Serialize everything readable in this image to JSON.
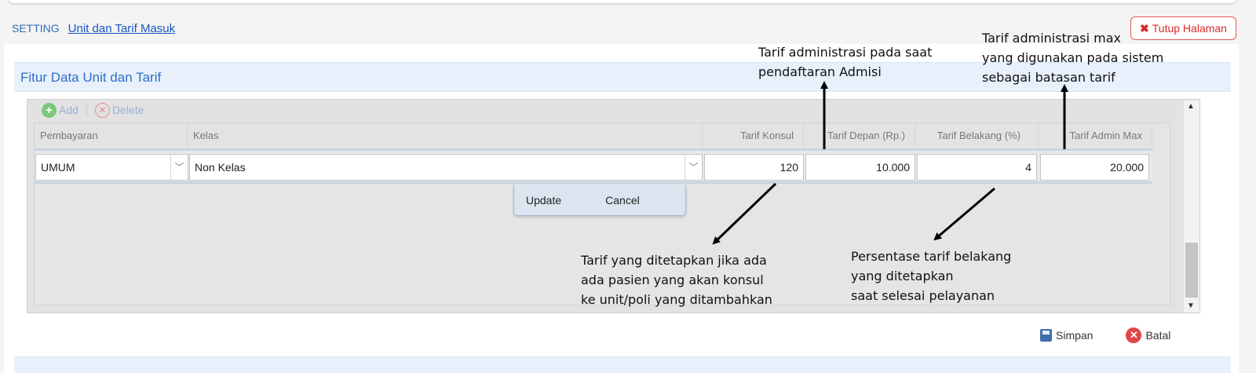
{
  "breadcrumb": {
    "setting": "SETTING",
    "current": "Unit dan Tarif Masuk"
  },
  "close_button": {
    "label": "Tutup Halaman",
    "icon": "close-icon"
  },
  "panel": {
    "title": "Fitur Data Unit dan Tarif"
  },
  "toolbar": {
    "add_label": "Add",
    "delete_label": "Delete"
  },
  "grid": {
    "columns": [
      "Pembayaran",
      "Kelas",
      "Tarif Konsul",
      "Tarif Depan (Rp.)",
      "Tarif Belakang (%)",
      "Tarif Admin Max"
    ],
    "edit_row": {
      "pembayaran": "UMUM",
      "kelas": "Non Kelas",
      "tarif_konsul": "120",
      "tarif_depan": "10.000",
      "tarif_belakang": "4",
      "tarif_admin_max": "20.000"
    },
    "row_editor": {
      "update_label": "Update",
      "cancel_label": "Cancel"
    }
  },
  "footer": {
    "save_label": "Simpan",
    "cancel_label": "Batal"
  },
  "annotations": {
    "admisi": "Tarif administrasi pada saat\npendaftaran Admisi",
    "admin_max": "Tarif administrasi max\nyang digunakan pada sistem\nsebagai batasan tarif",
    "konsul": "Tarif yang ditetapkan jika ada\nada pasien yang akan konsul\nke unit/poli yang ditambahkan",
    "belakang": "Persentase tarif belakang\nyang ditetapkan\nsaat selesai pelayanan"
  },
  "colors": {
    "accent": "#2f6fc8",
    "link": "#1a55c2",
    "danger": "#d52b2b",
    "header_bg": "#e8f0fb"
  }
}
